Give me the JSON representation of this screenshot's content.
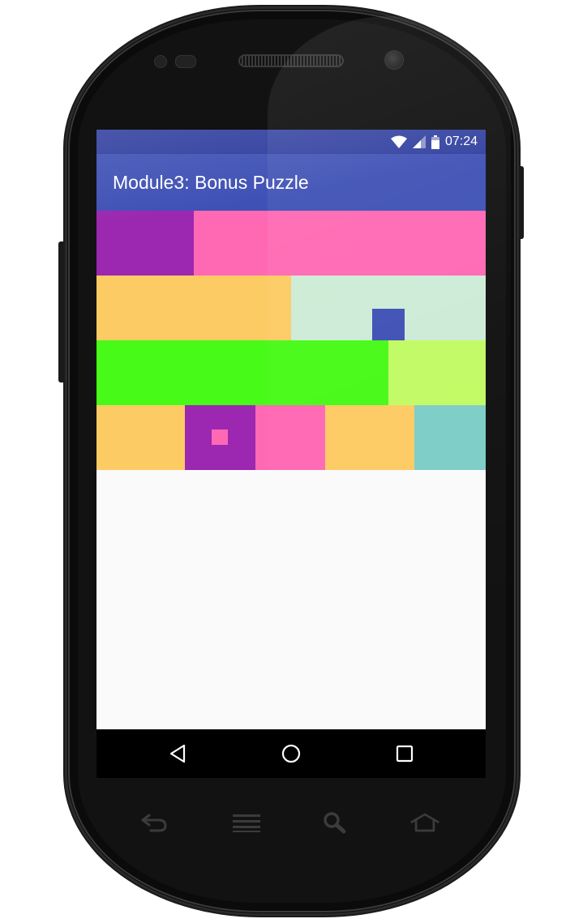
{
  "status_bar": {
    "time": "07:24",
    "icons": [
      "wifi-icon",
      "cell-signal-icon",
      "battery-icon"
    ]
  },
  "app_bar": {
    "title": "Module3: Bonus Puzzle"
  },
  "colors": {
    "status_bar": "#303f9f",
    "app_bar": "#3f51b5",
    "background": "#fafafa",
    "purple": "#9c27b0",
    "pink": "#ff69b4",
    "orange": "#fdcb64",
    "mint": "#cdebd6",
    "indigo": "#3f51b5",
    "green": "#48fa18",
    "lime": "#c2fb65",
    "teal": "#7ecdc7"
  },
  "puzzle_rows": [
    {
      "blocks": [
        "purple",
        "pink"
      ]
    },
    {
      "blocks": [
        "orange",
        "mint"
      ],
      "inner_square": "indigo"
    },
    {
      "blocks": [
        "green",
        "lime"
      ]
    },
    {
      "blocks": [
        "orange",
        "purple",
        "pink",
        "orange",
        "teal"
      ],
      "inner_square": "pink"
    }
  ],
  "nav_bar": {
    "buttons": [
      "back-icon",
      "home-icon",
      "recents-icon"
    ]
  },
  "hardware_keys": [
    "back-key-icon",
    "menu-key-icon",
    "search-key-icon",
    "home-key-icon"
  ]
}
